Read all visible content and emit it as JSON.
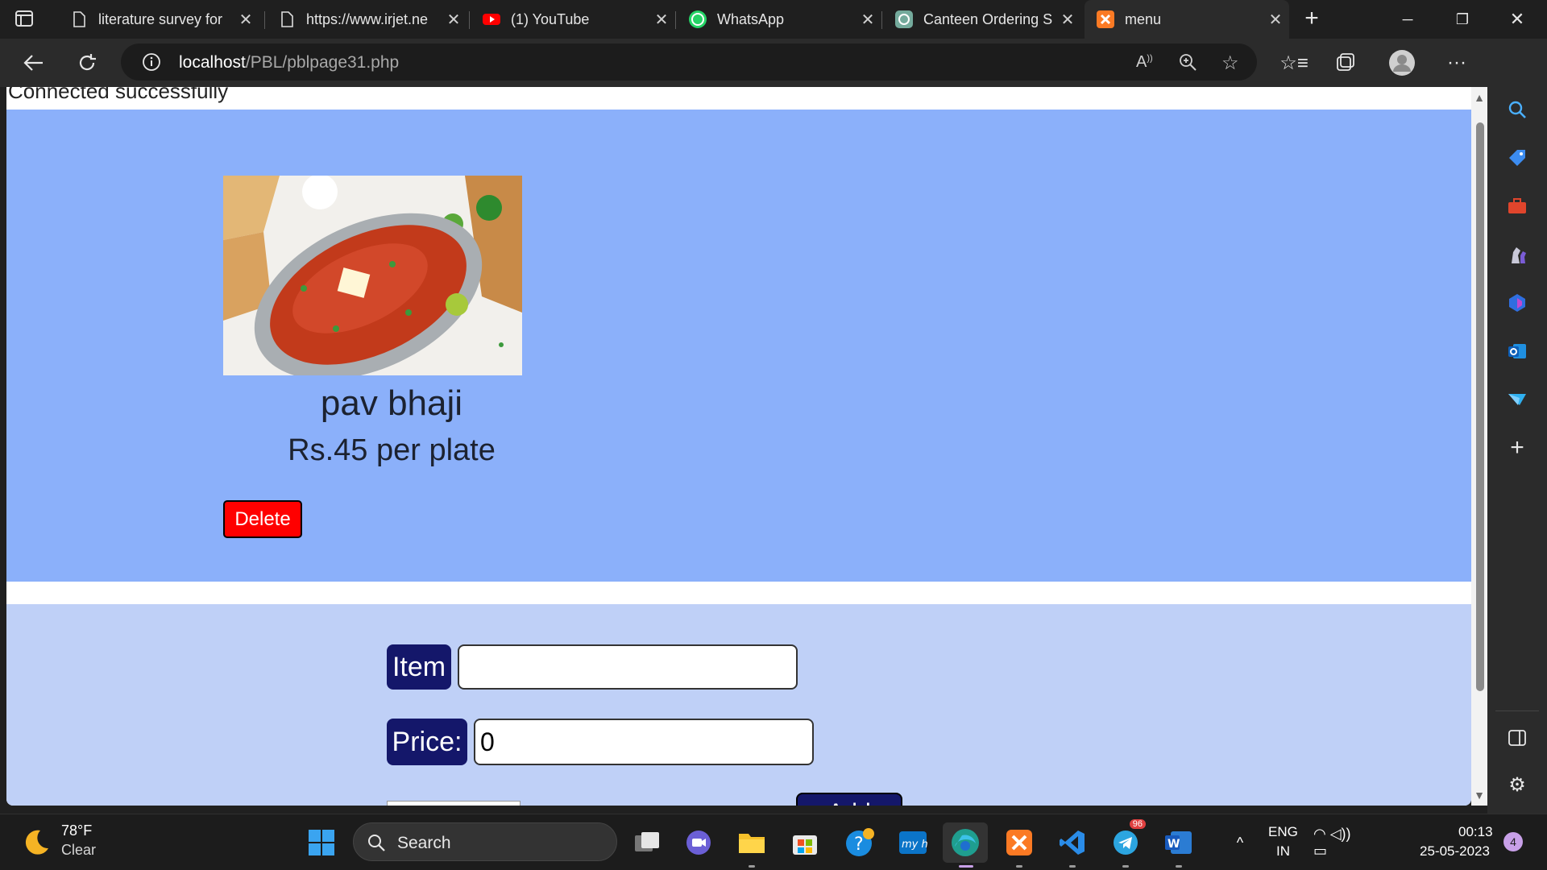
{
  "browser": {
    "tabs": [
      {
        "title": "literature survey for",
        "icon": "document-icon"
      },
      {
        "title": "https://www.irjet.ne",
        "icon": "document-icon"
      },
      {
        "title": "(1) YouTube",
        "icon": "youtube-icon"
      },
      {
        "title": "WhatsApp",
        "icon": "whatsapp-icon"
      },
      {
        "title": "Canteen Ordering S",
        "icon": "chatgpt-icon"
      },
      {
        "title": "menu",
        "icon": "xampp-icon"
      }
    ],
    "address": {
      "host": "localhost",
      "path": "/PBL/pblpage31.php"
    }
  },
  "page": {
    "connection_msg": "Connected successfully",
    "menu_item": {
      "name": "pav bhaji",
      "price": "Rs.45 per plate",
      "delete_label": "Delete"
    },
    "form": {
      "item_label": "Item",
      "item_value": "",
      "price_label": "Price:",
      "price_value": "0",
      "add_label": "Add"
    }
  },
  "taskbar": {
    "weather": {
      "temp": "78°F",
      "condition": "Clear"
    },
    "search_label": "Search",
    "language": {
      "line1": "ENG",
      "line2": "IN"
    },
    "clock": {
      "time": "00:13",
      "date": "25-05-2023"
    },
    "notification_count": "4",
    "telegram_badge": "96"
  },
  "colors": {
    "menu_bg": "#8bb0fa",
    "form_bg": "#bfd0f7",
    "label_bg": "#14176a",
    "delete_bg": "#ff0000"
  }
}
